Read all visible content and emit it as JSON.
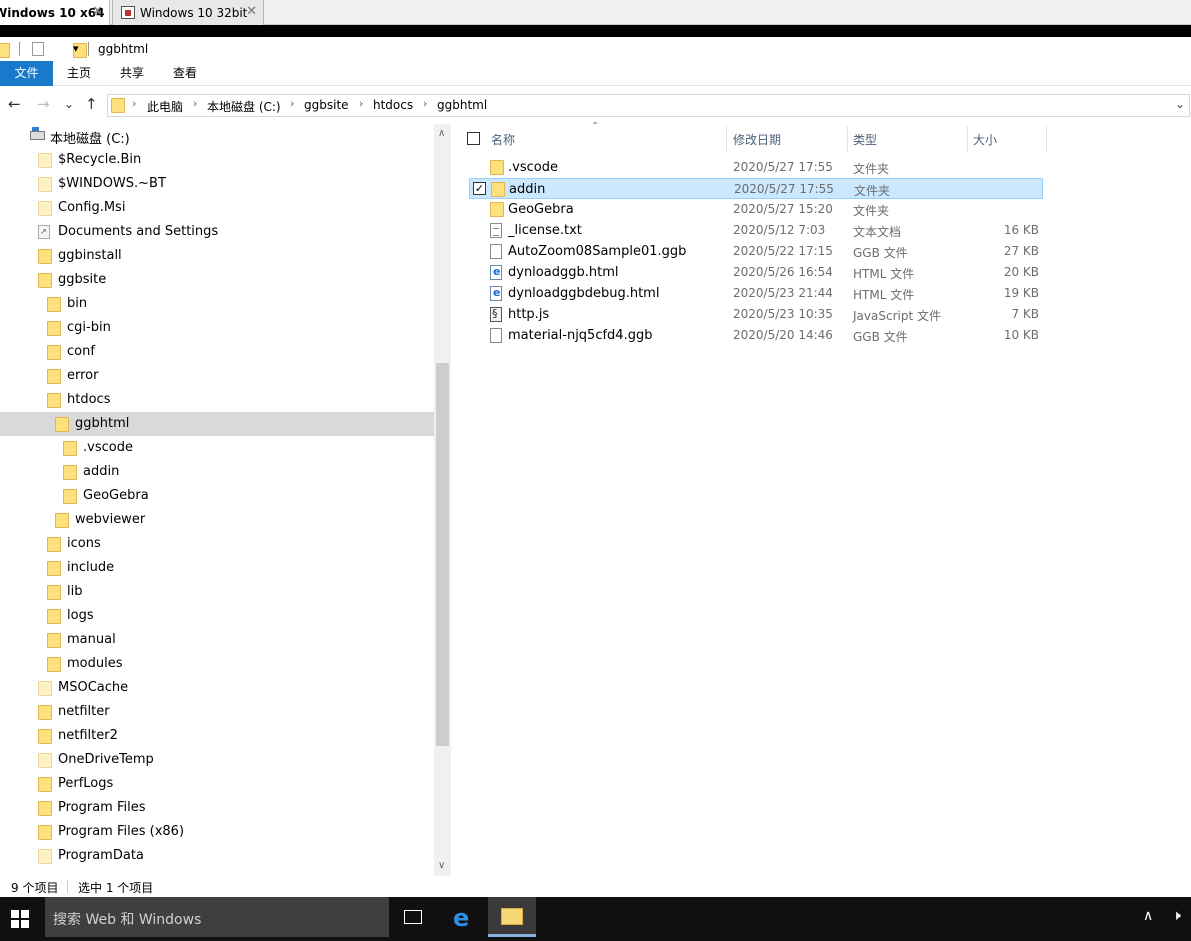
{
  "vm_tabs": [
    {
      "label": "Windows 10 x64",
      "close": "✕"
    },
    {
      "label": "Windows 10 32bit",
      "close": "✕"
    }
  ],
  "titlebar": {
    "folder_name": "ggbhtml",
    "dropdown": "▾"
  },
  "ribbon": {
    "tabs": [
      "文件",
      "主页",
      "共享",
      "查看"
    ]
  },
  "nav": {
    "back": "←",
    "forward": "→",
    "recent": "⌄",
    "up": "↑"
  },
  "address": {
    "crumbs": [
      "此电脑",
      "本地磁盘 (C:)",
      "ggbsite",
      "htdocs",
      "ggbhtml"
    ],
    "sep": "›",
    "dropdown": "⌄"
  },
  "tree": [
    {
      "label": "本地磁盘 (C:)",
      "icon": "drive-icon"
    },
    {
      "label": "$Recycle.Bin",
      "icon": "folder-pale"
    },
    {
      "label": "$WINDOWS.~BT",
      "icon": "folder-pale"
    },
    {
      "label": "Config.Msi",
      "icon": "folder-pale"
    },
    {
      "label": "Documents and Settings",
      "icon": "shortcut-icon"
    },
    {
      "label": "ggbinstall",
      "icon": "folder"
    },
    {
      "label": "ggbsite",
      "icon": "folder"
    },
    {
      "label": "bin",
      "icon": "folder"
    },
    {
      "label": "cgi-bin",
      "icon": "folder"
    },
    {
      "label": "conf",
      "icon": "folder"
    },
    {
      "label": "error",
      "icon": "folder"
    },
    {
      "label": "htdocs",
      "icon": "folder"
    },
    {
      "label": "ggbhtml",
      "icon": "folder",
      "selected": true
    },
    {
      "label": ".vscode",
      "icon": "folder"
    },
    {
      "label": "addin",
      "icon": "folder"
    },
    {
      "label": "GeoGebra",
      "icon": "folder"
    },
    {
      "label": "webviewer",
      "icon": "folder"
    },
    {
      "label": "icons",
      "icon": "folder"
    },
    {
      "label": "include",
      "icon": "folder"
    },
    {
      "label": "lib",
      "icon": "folder"
    },
    {
      "label": "logs",
      "icon": "folder"
    },
    {
      "label": "manual",
      "icon": "folder"
    },
    {
      "label": "modules",
      "icon": "folder"
    },
    {
      "label": "MSOCache",
      "icon": "folder-pale"
    },
    {
      "label": "netfilter",
      "icon": "folder"
    },
    {
      "label": "netfilter2",
      "icon": "folder"
    },
    {
      "label": "OneDriveTemp",
      "icon": "folder-pale"
    },
    {
      "label": "PerfLogs",
      "icon": "folder"
    },
    {
      "label": "Program Files",
      "icon": "folder"
    },
    {
      "label": "Program Files (x86)",
      "icon": "folder"
    },
    {
      "label": "ProgramData",
      "icon": "folder-pale"
    }
  ],
  "columns": {
    "name": "名称",
    "modified": "修改日期",
    "type": "类型",
    "size": "大小"
  },
  "files": [
    {
      "name": ".vscode",
      "modified": "2020/5/27 17:55",
      "type": "文件夹",
      "size": "",
      "icon": "folder"
    },
    {
      "name": "addin",
      "modified": "2020/5/27 17:55",
      "type": "文件夹",
      "size": "",
      "icon": "folder",
      "selected": true
    },
    {
      "name": "GeoGebra",
      "modified": "2020/5/27 15:20",
      "type": "文件夹",
      "size": "",
      "icon": "folder"
    },
    {
      "name": "_license.txt",
      "modified": "2020/5/12 7:03",
      "type": "文本文档",
      "size": "16 KB",
      "icon": "txt"
    },
    {
      "name": "AutoZoom08Sample01.ggb",
      "modified": "2020/5/22 17:15",
      "type": "GGB 文件",
      "size": "27 KB",
      "icon": "file"
    },
    {
      "name": "dynloadggb.html",
      "modified": "2020/5/26 16:54",
      "type": "HTML 文件",
      "size": "20 KB",
      "icon": "html"
    },
    {
      "name": "dynloadggbdebug.html",
      "modified": "2020/5/23 21:44",
      "type": "HTML 文件",
      "size": "19 KB",
      "icon": "html"
    },
    {
      "name": "http.js",
      "modified": "2020/5/23 10:35",
      "type": "JavaScript 文件",
      "size": "7 KB",
      "icon": "js"
    },
    {
      "name": "material-njq5cfd4.ggb",
      "modified": "2020/5/20 14:46",
      "type": "GGB 文件",
      "size": "10 KB",
      "icon": "file"
    }
  ],
  "status": {
    "count": "9 个项目",
    "selected": "选中 1 个项目"
  },
  "taskbar": {
    "search_placeholder": "搜索 Web 和 Windows",
    "tray_up": "∧",
    "tray_sound": "🕨"
  },
  "colors": {
    "accent": "#1979ca",
    "selection": "#cce8ff",
    "folder": "#fde17c"
  }
}
